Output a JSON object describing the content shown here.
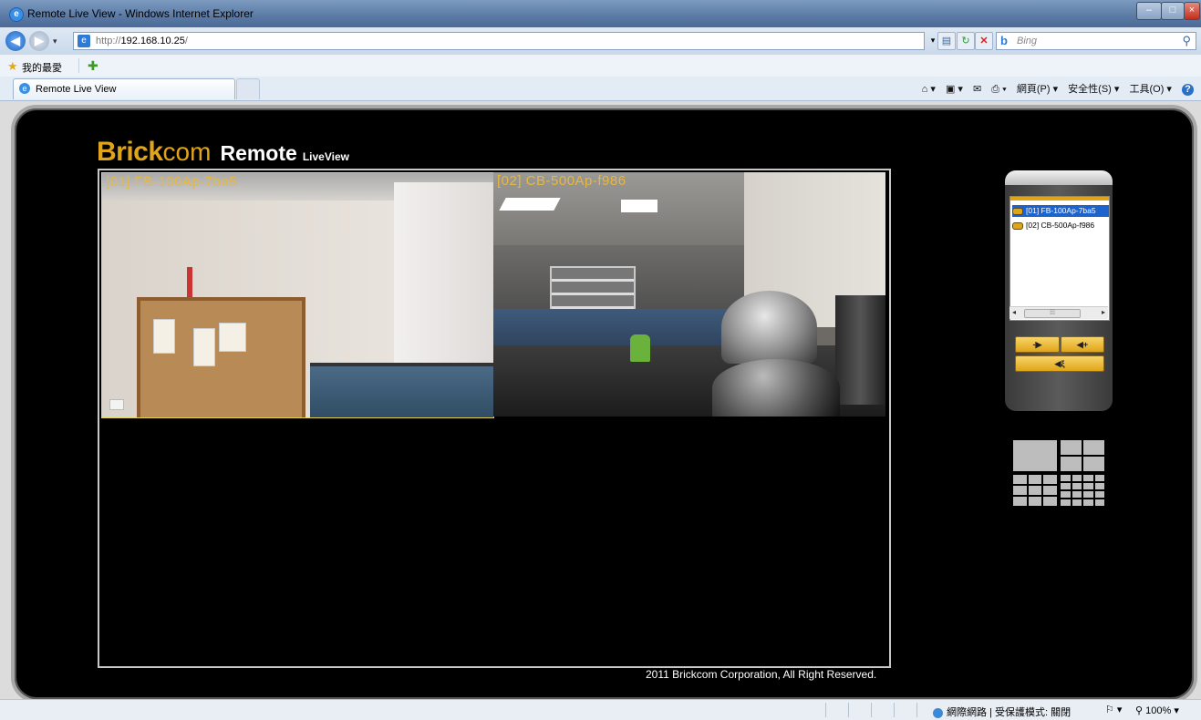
{
  "window": {
    "title": "Remote Live View - Windows Internet Explorer",
    "controls": [
      "–",
      "□",
      "×"
    ]
  },
  "address": {
    "prefix": "http://",
    "host": "192.168.10.25",
    "path": "/"
  },
  "search": {
    "engine": "Bing",
    "placeholder": "Bing"
  },
  "favorites": {
    "label": "我的最愛"
  },
  "tabs": [
    {
      "label": "Remote Live View"
    }
  ],
  "commands": {
    "page": "網頁(P) ▾",
    "safety": "安全性(S) ▾",
    "tools": "工具(O) ▾",
    "help": "?"
  },
  "brand": {
    "name_bold": "Brick",
    "name_light": "com",
    "product": "Remote",
    "sub": "LiveView"
  },
  "cameras": [
    {
      "label": "[01]  FB-100Ap-7ba5",
      "list_label": "[01] FB-100Ap-7ba5",
      "selected": true
    },
    {
      "label": "[02]  CB-500Ap-f986",
      "list_label": "[02] CB-500Ap-f986",
      "selected": false
    }
  ],
  "audio_buttons": {
    "mic_down": "-▶",
    "speaker_up": "◀+",
    "speaker": "◀ξ"
  },
  "footer": {
    "copyright": "2011 Brickcom Corporation, All Right Reserved."
  },
  "status": {
    "zone": "網際網路 | 受保護模式: 關閉",
    "zoom": "100%"
  },
  "colors": {
    "brand": "#e0a419",
    "selection": "#1e63cc"
  }
}
